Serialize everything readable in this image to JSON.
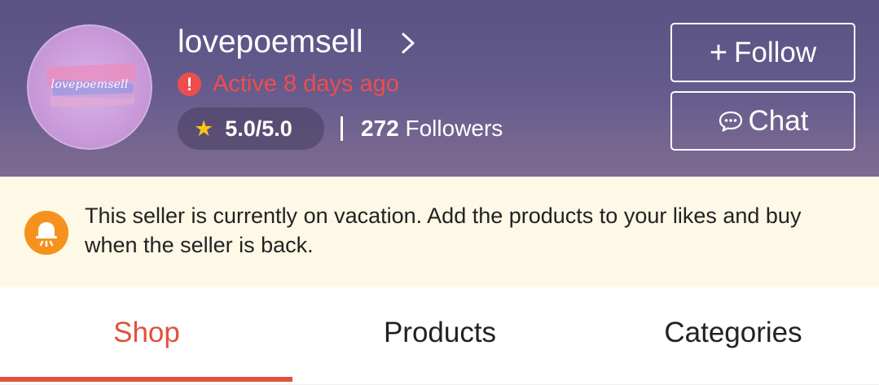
{
  "seller": {
    "name": "lovepoemsell",
    "avatar_text": "lovepoemsell",
    "status_text": "Active 8 days ago",
    "rating": "5.0/5.0",
    "followers_count": "272",
    "followers_label": "Followers"
  },
  "actions": {
    "follow_label": "Follow",
    "chat_label": "Chat"
  },
  "vacation_notice": {
    "text": "This seller is currently on vacation. Add the products to your likes and buy when the seller is back."
  },
  "tabs": [
    {
      "label": "Shop",
      "active": true
    },
    {
      "label": "Products",
      "active": false
    },
    {
      "label": "Categories",
      "active": false
    }
  ],
  "icons": {
    "name_chevron": "chevron-right-icon",
    "status": "alert-icon",
    "rating": "star-icon",
    "follow": "plus-icon",
    "chat": "chat-bubble-icon",
    "vacation": "bell-icon"
  },
  "colors": {
    "accent": "#e2513a",
    "status_red": "#ee4d4d",
    "star": "#f5c518",
    "bell": "#f5921e",
    "notice_bg": "#fef8e7"
  }
}
